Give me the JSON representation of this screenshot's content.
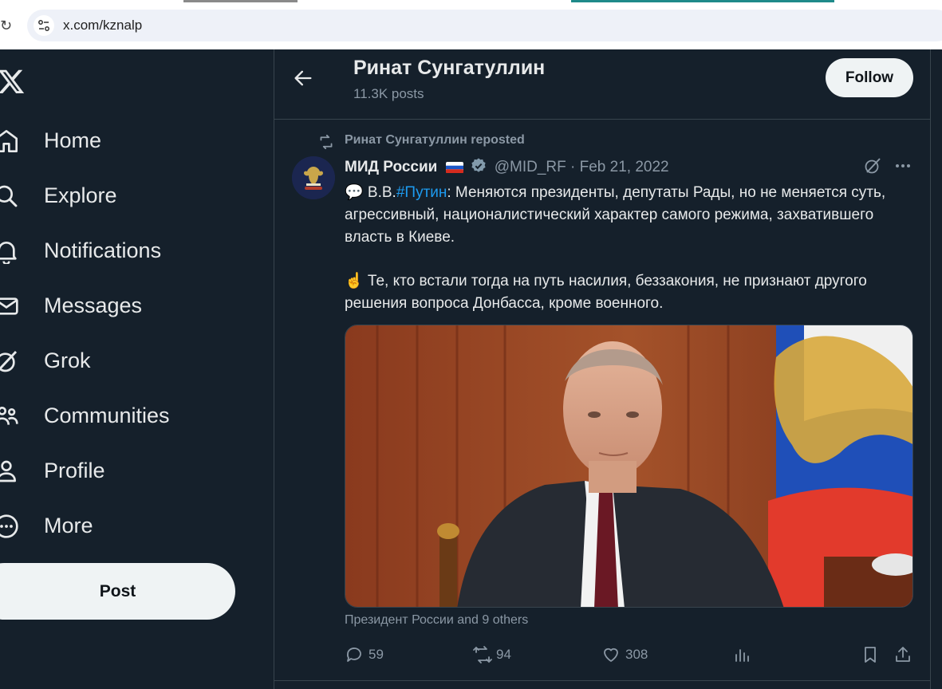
{
  "browser": {
    "url": "x.com/kznalp"
  },
  "nav": {
    "items": [
      {
        "label": "Home",
        "icon": "home-icon"
      },
      {
        "label": "Explore",
        "icon": "search-icon"
      },
      {
        "label": "Notifications",
        "icon": "bell-icon"
      },
      {
        "label": "Messages",
        "icon": "envelope-icon"
      },
      {
        "label": "Grok",
        "icon": "grok-icon"
      },
      {
        "label": "Communities",
        "icon": "communities-icon"
      },
      {
        "label": "Profile",
        "icon": "person-icon"
      },
      {
        "label": "More",
        "icon": "more-circle-icon"
      }
    ],
    "post_label": "Post"
  },
  "header": {
    "name": "Ринат Сунгатуллин",
    "post_count": "11.3K posts",
    "follow_label": "Follow"
  },
  "tweet": {
    "repost_text": "Ринат Сунгатуллин reposted",
    "author_name": "МИД России",
    "handle_date": "@MID_RF · Feb 21, 2022",
    "text_p1_prefix": "💬 В.В.",
    "text_p1_hashtag": "#Путин",
    "text_p1_rest": ": Меняются президенты, депутаты Рады, но не меняется суть, агрессивный, националистический характер самого режима, захватившего власть в Киеве.",
    "text_p2": "☝️ Те, кто встали тогда на путь насилия, беззакония, не признают другого решения вопроса Донбасса, кроме военного.",
    "tagged": "Президент России and 9 others",
    "replies": "59",
    "reposts": "94",
    "likes": "308"
  },
  "colors": {
    "background": "#15202b",
    "text": "#e7e9ea",
    "secondary": "#8b98a5",
    "accent": "#1d9bf0",
    "border": "#38444d"
  }
}
